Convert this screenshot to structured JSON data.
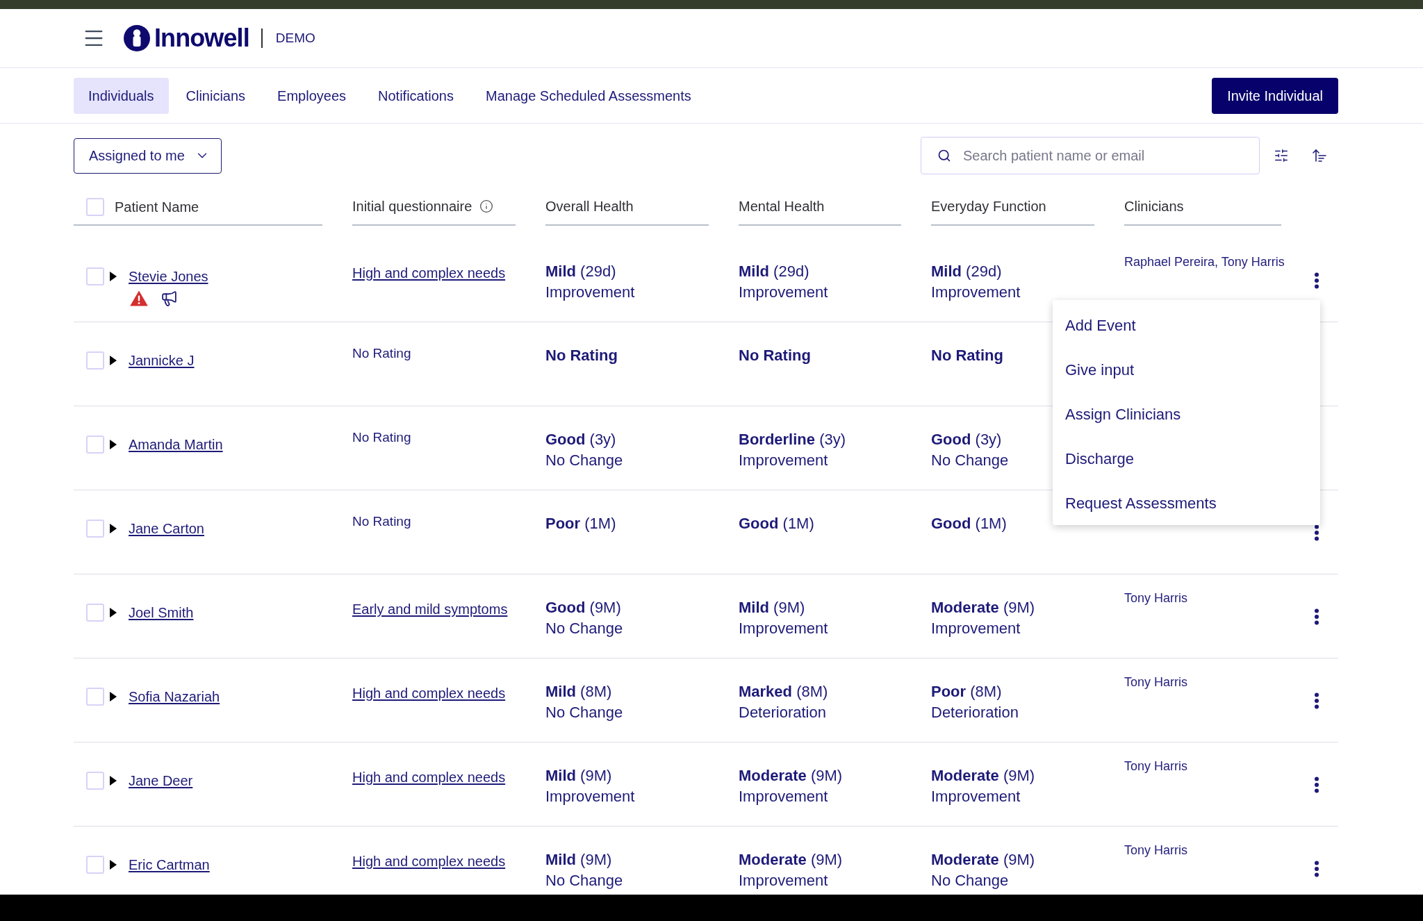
{
  "header": {
    "brand": "Innowell",
    "environment": "DEMO"
  },
  "tabs": [
    {
      "label": "Individuals",
      "selected": true
    },
    {
      "label": "Clinicians",
      "selected": false
    },
    {
      "label": "Employees",
      "selected": false
    },
    {
      "label": "Notifications",
      "selected": false
    },
    {
      "label": "Manage Scheduled Assessments",
      "selected": false
    }
  ],
  "invite_button": "Invite Individual",
  "filter": {
    "value": "Assigned to me"
  },
  "search": {
    "placeholder": "Search patient name or email"
  },
  "table": {
    "select_all_checked": false,
    "columns": [
      {
        "label": "Patient Name",
        "info": false
      },
      {
        "label": "Initial questionnaire",
        "info": true
      },
      {
        "label": "Overall Health",
        "info": false
      },
      {
        "label": "Mental Health",
        "info": false
      },
      {
        "label": "Everyday Function",
        "info": false
      },
      {
        "label": "Clinicians",
        "info": false
      }
    ],
    "rows": [
      {
        "name": "Stevie Jones",
        "checked": false,
        "expanded": false,
        "risk_alert": true,
        "notice": true,
        "questionnaire": {
          "text": "High and complex needs",
          "kind": "link"
        },
        "scores": [
          {
            "rating": "Mild",
            "age": "(29d)",
            "trend": "Improvement"
          },
          {
            "rating": "Mild",
            "age": "(29d)",
            "trend": "Improvement"
          },
          {
            "rating": "Mild",
            "age": "(29d)",
            "trend": "Improvement"
          }
        ],
        "clinicians": "Raphael Pereira, Tony Harris",
        "actions_menu": {
          "items": [
            "Add Event",
            "Give input",
            "Assign Clinicians",
            "Discharge",
            "Request Assessments"
          ]
        }
      },
      {
        "name": "Jannicke J",
        "checked": false,
        "expanded": false,
        "risk_alert": false,
        "notice": false,
        "questionnaire": {
          "text": "No Rating",
          "kind": "plain"
        },
        "scores": [
          {
            "rating": "No Rating"
          },
          {
            "rating": "No Rating"
          },
          {
            "rating": "No Rating"
          }
        ]
      },
      {
        "name": "Amanda Martin",
        "checked": false,
        "expanded": false,
        "risk_alert": false,
        "notice": false,
        "questionnaire": {
          "text": "No Rating",
          "kind": "plain"
        },
        "scores": [
          {
            "rating": "Good",
            "age": "(3y)",
            "trend": "No Change"
          },
          {
            "rating": "Borderline",
            "age": "(3y)",
            "trend": "Improvement"
          },
          {
            "rating": "Good",
            "age": "(3y)",
            "trend": "No Change"
          }
        ]
      },
      {
        "name": "Jane Carton",
        "checked": false,
        "expanded": false,
        "risk_alert": false,
        "notice": false,
        "questionnaire": {
          "text": "No Rating",
          "kind": "plain"
        },
        "scores": [
          {
            "rating": "Poor",
            "age": "(1M)"
          },
          {
            "rating": "Good",
            "age": "(1M)"
          },
          {
            "rating": "Good",
            "age": "(1M)"
          }
        ]
      },
      {
        "name": "Joel Smith",
        "checked": false,
        "expanded": false,
        "risk_alert": false,
        "notice": false,
        "questionnaire": {
          "text": "Early and mild symptoms",
          "kind": "link"
        },
        "scores": [
          {
            "rating": "Good",
            "age": "(9M)",
            "trend": "No Change"
          },
          {
            "rating": "Mild",
            "age": "(9M)",
            "trend": "Improvement"
          },
          {
            "rating": "Moderate",
            "age": "(9M)",
            "trend": "Improvement"
          }
        ],
        "clinicians": "Tony Harris"
      },
      {
        "name": "Sofia Nazariah",
        "checked": false,
        "expanded": false,
        "risk_alert": false,
        "notice": false,
        "questionnaire": {
          "text": "High and complex needs",
          "kind": "link"
        },
        "scores": [
          {
            "rating": "Mild",
            "age": "(8M)",
            "trend": "No Change"
          },
          {
            "rating": "Marked",
            "age": "(8M)",
            "trend": "Deterioration"
          },
          {
            "rating": "Poor",
            "age": "(8M)",
            "trend": "Deterioration"
          }
        ],
        "clinicians": "Tony Harris"
      },
      {
        "name": "Jane Deer",
        "checked": false,
        "expanded": false,
        "risk_alert": false,
        "notice": false,
        "questionnaire": {
          "text": "High and complex needs",
          "kind": "link"
        },
        "scores": [
          {
            "rating": "Mild",
            "age": "(9M)",
            "trend": "Improvement"
          },
          {
            "rating": "Moderate",
            "age": "(9M)",
            "trend": "Improvement"
          },
          {
            "rating": "Moderate",
            "age": "(9M)",
            "trend": "Improvement"
          }
        ],
        "clinicians": "Tony Harris"
      },
      {
        "name": "Eric Cartman",
        "checked": false,
        "expanded": false,
        "risk_alert": false,
        "notice": false,
        "questionnaire": {
          "text": "High and complex needs",
          "kind": "link"
        },
        "scores": [
          {
            "rating": "Mild",
            "age": "(9M)",
            "trend": "No Change"
          },
          {
            "rating": "Moderate",
            "age": "(9M)",
            "trend": "Improvement"
          },
          {
            "rating": "Moderate",
            "age": "(9M)",
            "trend": "No Change"
          }
        ],
        "clinicians": "Tony Harris"
      }
    ]
  }
}
